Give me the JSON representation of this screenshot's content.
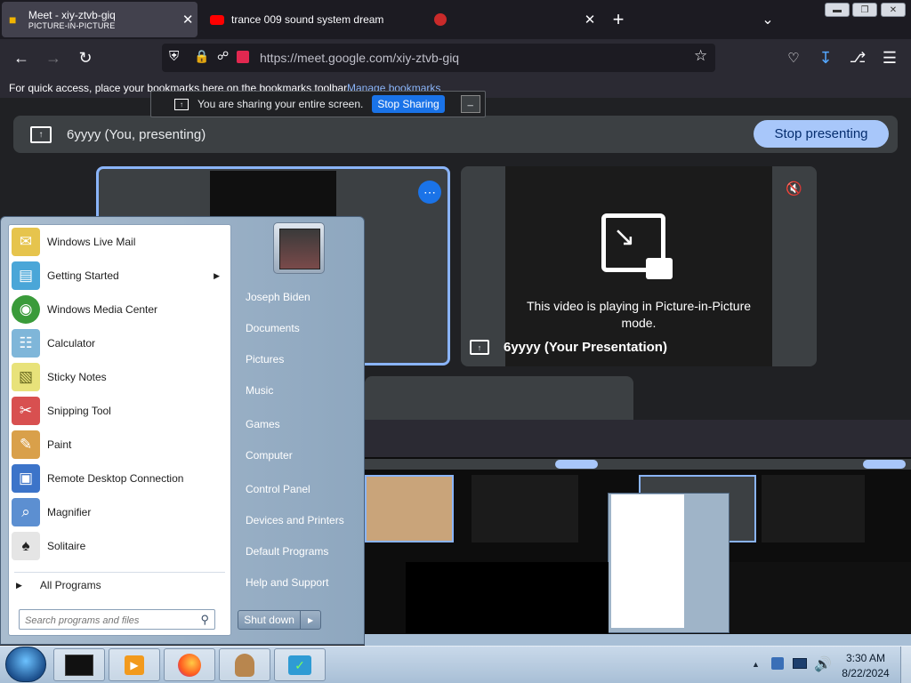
{
  "browser": {
    "tab1": {
      "title": "Meet - xiy-ztvb-giq",
      "subtitle": "PICTURE-IN-PICTURE"
    },
    "tab2": {
      "title": "trance 009 sound system dream"
    },
    "new_tab": "+",
    "url": "https://meet.google.com/xiy-ztvb-giq",
    "bookmarks_text": "For quick access, place your bookmarks here on the bookmarks toolbar.",
    "manage_bookmarks": "Manage bookmarks"
  },
  "sharebar": {
    "text": "You are sharing your entire screen.",
    "stop": "Stop Sharing",
    "hide": "_"
  },
  "meet": {
    "presenting_label": "6yyyy (You, presenting)",
    "stop_presenting": "Stop presenting",
    "pip_message": "This video is playing in Picture-in-Picture mode.",
    "presentation_name": "6yyyy (Your Presentation)",
    "more_options": "⋯"
  },
  "startmenu": {
    "programs": [
      {
        "label": "Windows Live Mail",
        "icon": "mail-icon",
        "color": "#e6c44d",
        "glyph": "✉"
      },
      {
        "label": "Getting Started",
        "icon": "getting-started-icon",
        "color": "#4aa6d8",
        "glyph": "▤",
        "submenu": true
      },
      {
        "label": "Windows Media Center",
        "icon": "media-center-icon",
        "color": "#3a9b3a",
        "glyph": "◉"
      },
      {
        "label": "Calculator",
        "icon": "calculator-icon",
        "color": "#7fb6d9",
        "glyph": "☷"
      },
      {
        "label": "Sticky Notes",
        "icon": "sticky-notes-icon",
        "color": "#e8e27a",
        "glyph": "▧"
      },
      {
        "label": "Snipping Tool",
        "icon": "snipping-tool-icon",
        "color": "#d85050",
        "glyph": "✂"
      },
      {
        "label": "Paint",
        "icon": "paint-icon",
        "color": "#d9a04a",
        "glyph": "✎"
      },
      {
        "label": "Remote Desktop Connection",
        "icon": "remote-desktop-icon",
        "color": "#3c74c9",
        "glyph": "▣"
      },
      {
        "label": "Magnifier",
        "icon": "magnifier-icon",
        "color": "#5c8fd1",
        "glyph": "⌕"
      },
      {
        "label": "Solitaire",
        "icon": "solitaire-icon",
        "color": "#e5e5e5",
        "glyph": "♠"
      }
    ],
    "all_programs": "All Programs",
    "search_placeholder": "Search programs and files",
    "right_items": [
      "Joseph Biden",
      "Documents",
      "Pictures",
      "Music",
      "Games",
      "Computer",
      "Control Panel",
      "Devices and Printers",
      "Default Programs",
      "Help and Support"
    ],
    "shutdown": "Shut down"
  },
  "taskbar": {
    "time": "3:30 AM",
    "date": "8/22/2024",
    "tray_arrow": "▲"
  },
  "colors": {
    "accent": "#1a73e8",
    "presenting_button": "#a8c7fa",
    "tile_border": "#8ab4f8"
  }
}
